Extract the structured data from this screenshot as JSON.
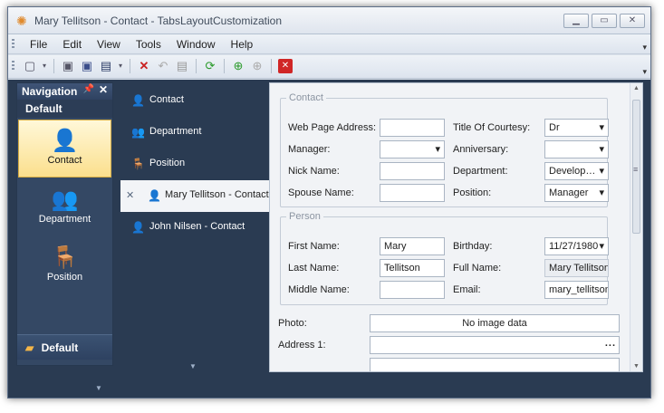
{
  "window": {
    "title": "Mary Tellitson - Contact - TabsLayoutCustomization",
    "buttons": [
      "▁",
      "▭",
      "✕"
    ]
  },
  "menu": [
    "File",
    "Edit",
    "View",
    "Tools",
    "Window",
    "Help"
  ],
  "toolbar": {
    "icons": [
      "new-doc-icon",
      "save-icon",
      "save-close-icon",
      "save-new-icon",
      "delete-icon",
      "undo-icon",
      "print-icon",
      "refresh-icon",
      "next-icon",
      "prev-icon",
      "close-doc-icon"
    ]
  },
  "navigation": {
    "header": "Navigation",
    "group": "Default",
    "items": [
      {
        "label": "Contact",
        "selected": true
      },
      {
        "label": "Department"
      },
      {
        "label": "Position"
      }
    ],
    "footer_group": "Default"
  },
  "tabs": [
    {
      "label": "Contact"
    },
    {
      "label": "Department"
    },
    {
      "label": "Position"
    },
    {
      "label": "Mary Tellitson - Contact",
      "active": true
    },
    {
      "label": "John Nilsen - Contact"
    }
  ],
  "form": {
    "contact_group": "Contact",
    "web_page_label": "Web Page Address:",
    "web_page": "",
    "title_label": "Title Of Courtesy:",
    "title": "Dr",
    "manager_label": "Manager:",
    "manager": "",
    "anniversary_label": "Anniversary:",
    "anniversary": "",
    "nick_label": "Nick Name:",
    "nick": "",
    "department_label": "Department:",
    "department": "Develop…",
    "spouse_label": "Spouse Name:",
    "spouse": "",
    "position_label": "Position:",
    "position": "Manager",
    "person_group": "Person",
    "first_label": "First Name:",
    "first": "Mary",
    "birthday_label": "Birthday:",
    "birthday": "11/27/1980",
    "last_label": "Last Name:",
    "last": "Tellitson",
    "fullname_label": "Full Name:",
    "fullname": "Mary Tellitson",
    "middle_label": "Middle Name:",
    "middle": "",
    "email_label": "Email:",
    "email": "mary_tellitson",
    "photo_label": "Photo:",
    "photo": "No image data",
    "address1_label": "Address 1:",
    "address1": "",
    "address_ellipsis": "..."
  }
}
